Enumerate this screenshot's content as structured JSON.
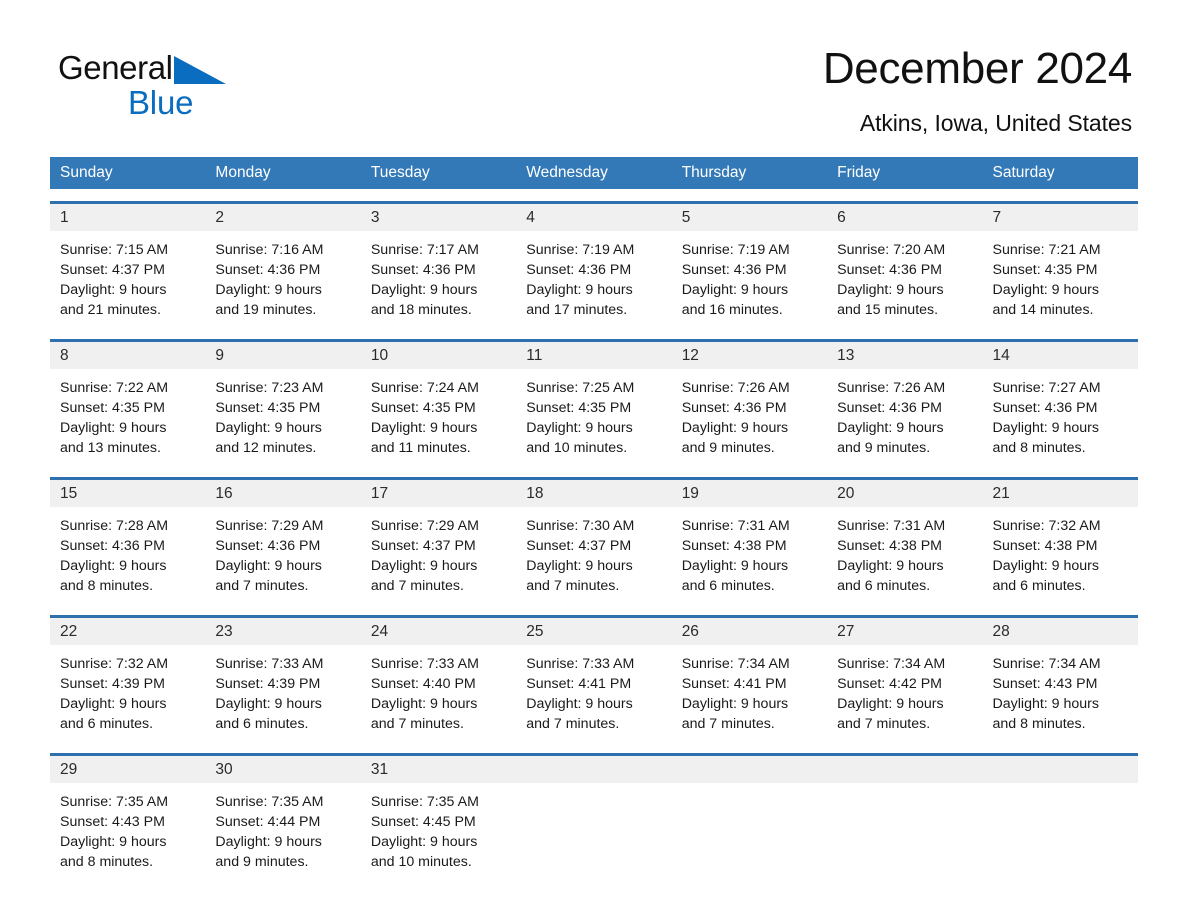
{
  "brand": {
    "name_part1": "General",
    "name_part2": "Blue",
    "triangle_color": "#0B6DBF",
    "text_color": "#111111"
  },
  "header": {
    "title": "December 2024",
    "subtitle": "Atkins, Iowa, United States"
  },
  "theme": {
    "header_blue": "#3379B8",
    "week_border_blue": "#2E6FAE",
    "day_band_gray": "#f0f0f0",
    "page_background": "#ffffff"
  },
  "weekdays": [
    "Sunday",
    "Monday",
    "Tuesday",
    "Wednesday",
    "Thursday",
    "Friday",
    "Saturday"
  ],
  "weeks": [
    [
      {
        "day": "1",
        "sunrise": "Sunrise: 7:15 AM",
        "sunset": "Sunset: 4:37 PM",
        "daylight1": "Daylight: 9 hours",
        "daylight2": "and 21 minutes."
      },
      {
        "day": "2",
        "sunrise": "Sunrise: 7:16 AM",
        "sunset": "Sunset: 4:36 PM",
        "daylight1": "Daylight: 9 hours",
        "daylight2": "and 19 minutes."
      },
      {
        "day": "3",
        "sunrise": "Sunrise: 7:17 AM",
        "sunset": "Sunset: 4:36 PM",
        "daylight1": "Daylight: 9 hours",
        "daylight2": "and 18 minutes."
      },
      {
        "day": "4",
        "sunrise": "Sunrise: 7:19 AM",
        "sunset": "Sunset: 4:36 PM",
        "daylight1": "Daylight: 9 hours",
        "daylight2": "and 17 minutes."
      },
      {
        "day": "5",
        "sunrise": "Sunrise: 7:19 AM",
        "sunset": "Sunset: 4:36 PM",
        "daylight1": "Daylight: 9 hours",
        "daylight2": "and 16 minutes."
      },
      {
        "day": "6",
        "sunrise": "Sunrise: 7:20 AM",
        "sunset": "Sunset: 4:36 PM",
        "daylight1": "Daylight: 9 hours",
        "daylight2": "and 15 minutes."
      },
      {
        "day": "7",
        "sunrise": "Sunrise: 7:21 AM",
        "sunset": "Sunset: 4:35 PM",
        "daylight1": "Daylight: 9 hours",
        "daylight2": "and 14 minutes."
      }
    ],
    [
      {
        "day": "8",
        "sunrise": "Sunrise: 7:22 AM",
        "sunset": "Sunset: 4:35 PM",
        "daylight1": "Daylight: 9 hours",
        "daylight2": "and 13 minutes."
      },
      {
        "day": "9",
        "sunrise": "Sunrise: 7:23 AM",
        "sunset": "Sunset: 4:35 PM",
        "daylight1": "Daylight: 9 hours",
        "daylight2": "and 12 minutes."
      },
      {
        "day": "10",
        "sunrise": "Sunrise: 7:24 AM",
        "sunset": "Sunset: 4:35 PM",
        "daylight1": "Daylight: 9 hours",
        "daylight2": "and 11 minutes."
      },
      {
        "day": "11",
        "sunrise": "Sunrise: 7:25 AM",
        "sunset": "Sunset: 4:35 PM",
        "daylight1": "Daylight: 9 hours",
        "daylight2": "and 10 minutes."
      },
      {
        "day": "12",
        "sunrise": "Sunrise: 7:26 AM",
        "sunset": "Sunset: 4:36 PM",
        "daylight1": "Daylight: 9 hours",
        "daylight2": "and 9 minutes."
      },
      {
        "day": "13",
        "sunrise": "Sunrise: 7:26 AM",
        "sunset": "Sunset: 4:36 PM",
        "daylight1": "Daylight: 9 hours",
        "daylight2": "and 9 minutes."
      },
      {
        "day": "14",
        "sunrise": "Sunrise: 7:27 AM",
        "sunset": "Sunset: 4:36 PM",
        "daylight1": "Daylight: 9 hours",
        "daylight2": "and 8 minutes."
      }
    ],
    [
      {
        "day": "15",
        "sunrise": "Sunrise: 7:28 AM",
        "sunset": "Sunset: 4:36 PM",
        "daylight1": "Daylight: 9 hours",
        "daylight2": "and 8 minutes."
      },
      {
        "day": "16",
        "sunrise": "Sunrise: 7:29 AM",
        "sunset": "Sunset: 4:36 PM",
        "daylight1": "Daylight: 9 hours",
        "daylight2": "and 7 minutes."
      },
      {
        "day": "17",
        "sunrise": "Sunrise: 7:29 AM",
        "sunset": "Sunset: 4:37 PM",
        "daylight1": "Daylight: 9 hours",
        "daylight2": "and 7 minutes."
      },
      {
        "day": "18",
        "sunrise": "Sunrise: 7:30 AM",
        "sunset": "Sunset: 4:37 PM",
        "daylight1": "Daylight: 9 hours",
        "daylight2": "and 7 minutes."
      },
      {
        "day": "19",
        "sunrise": "Sunrise: 7:31 AM",
        "sunset": "Sunset: 4:38 PM",
        "daylight1": "Daylight: 9 hours",
        "daylight2": "and 6 minutes."
      },
      {
        "day": "20",
        "sunrise": "Sunrise: 7:31 AM",
        "sunset": "Sunset: 4:38 PM",
        "daylight1": "Daylight: 9 hours",
        "daylight2": "and 6 minutes."
      },
      {
        "day": "21",
        "sunrise": "Sunrise: 7:32 AM",
        "sunset": "Sunset: 4:38 PM",
        "daylight1": "Daylight: 9 hours",
        "daylight2": "and 6 minutes."
      }
    ],
    [
      {
        "day": "22",
        "sunrise": "Sunrise: 7:32 AM",
        "sunset": "Sunset: 4:39 PM",
        "daylight1": "Daylight: 9 hours",
        "daylight2": "and 6 minutes."
      },
      {
        "day": "23",
        "sunrise": "Sunrise: 7:33 AM",
        "sunset": "Sunset: 4:39 PM",
        "daylight1": "Daylight: 9 hours",
        "daylight2": "and 6 minutes."
      },
      {
        "day": "24",
        "sunrise": "Sunrise: 7:33 AM",
        "sunset": "Sunset: 4:40 PM",
        "daylight1": "Daylight: 9 hours",
        "daylight2": "and 7 minutes."
      },
      {
        "day": "25",
        "sunrise": "Sunrise: 7:33 AM",
        "sunset": "Sunset: 4:41 PM",
        "daylight1": "Daylight: 9 hours",
        "daylight2": "and 7 minutes."
      },
      {
        "day": "26",
        "sunrise": "Sunrise: 7:34 AM",
        "sunset": "Sunset: 4:41 PM",
        "daylight1": "Daylight: 9 hours",
        "daylight2": "and 7 minutes."
      },
      {
        "day": "27",
        "sunrise": "Sunrise: 7:34 AM",
        "sunset": "Sunset: 4:42 PM",
        "daylight1": "Daylight: 9 hours",
        "daylight2": "and 7 minutes."
      },
      {
        "day": "28",
        "sunrise": "Sunrise: 7:34 AM",
        "sunset": "Sunset: 4:43 PM",
        "daylight1": "Daylight: 9 hours",
        "daylight2": "and 8 minutes."
      }
    ],
    [
      {
        "day": "29",
        "sunrise": "Sunrise: 7:35 AM",
        "sunset": "Sunset: 4:43 PM",
        "daylight1": "Daylight: 9 hours",
        "daylight2": "and 8 minutes."
      },
      {
        "day": "30",
        "sunrise": "Sunrise: 7:35 AM",
        "sunset": "Sunset: 4:44 PM",
        "daylight1": "Daylight: 9 hours",
        "daylight2": "and 9 minutes."
      },
      {
        "day": "31",
        "sunrise": "Sunrise: 7:35 AM",
        "sunset": "Sunset: 4:45 PM",
        "daylight1": "Daylight: 9 hours",
        "daylight2": "and 10 minutes."
      },
      {
        "day": "",
        "sunrise": "",
        "sunset": "",
        "daylight1": "",
        "daylight2": ""
      },
      {
        "day": "",
        "sunrise": "",
        "sunset": "",
        "daylight1": "",
        "daylight2": ""
      },
      {
        "day": "",
        "sunrise": "",
        "sunset": "",
        "daylight1": "",
        "daylight2": ""
      },
      {
        "day": "",
        "sunrise": "",
        "sunset": "",
        "daylight1": "",
        "daylight2": ""
      }
    ]
  ]
}
